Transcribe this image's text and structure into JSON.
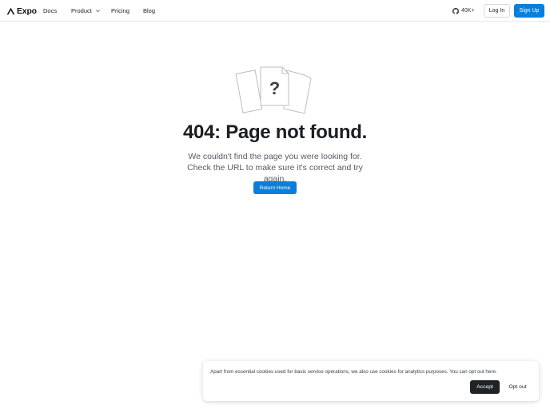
{
  "header": {
    "logo_text": "Expo",
    "nav": {
      "docs": "Docs",
      "product": "Product",
      "pricing": "Pricing",
      "blog": "Blog"
    },
    "github_stars": "40K+",
    "login_label": "Log In",
    "signup_label": "Sign Up"
  },
  "main": {
    "illustration_glyph": "?",
    "title": "404: Page not found.",
    "description": "We couldn't find the page you were looking for. Check the URL to make sure it's correct and try again.",
    "return_label": "Return Home"
  },
  "cookie_banner": {
    "text": "Apart from essential cookies used for basic service operations, we also use cookies for analytics purposes. You can opt out here.",
    "accept_label": "Accept",
    "opt_out_label": "Opt out"
  },
  "colors": {
    "accent": "#0a7ed9",
    "text": "#1b1f24",
    "muted": "#555b63",
    "dark_button": "#1f2226"
  },
  "icons": {
    "logo": "expo-logo-icon",
    "product_dropdown": "chevron-down-icon",
    "github": "github-icon",
    "illustration": "missing-documents-icon"
  }
}
